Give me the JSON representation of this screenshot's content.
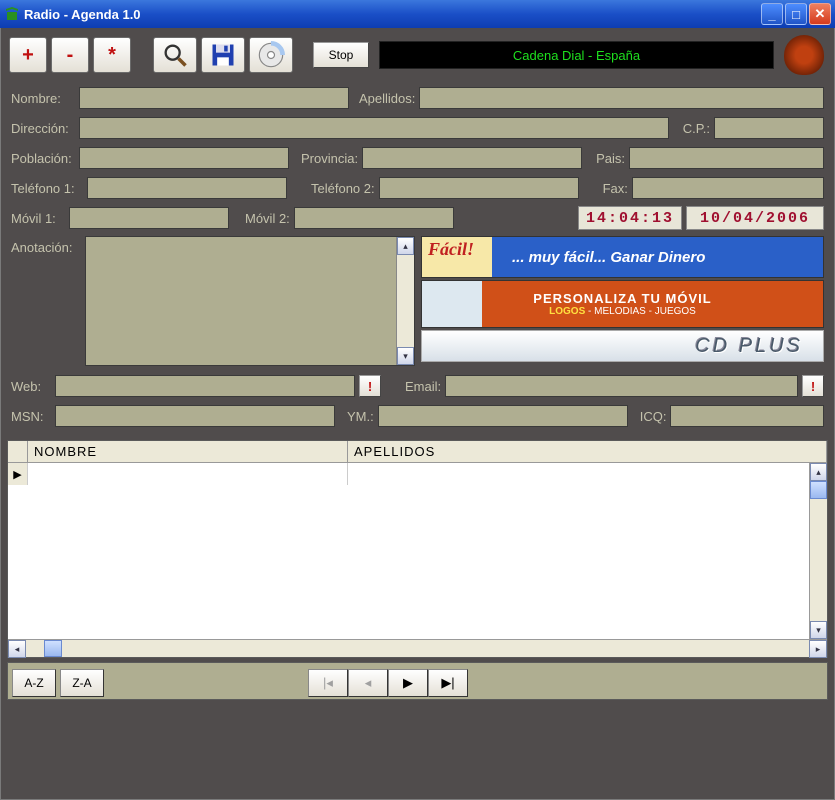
{
  "window": {
    "title": "Radio - Agenda 1.0"
  },
  "toolbar": {
    "add": "+",
    "remove": "-",
    "star": "*",
    "stop": "Stop",
    "radio_station": "Cadena Dial - España"
  },
  "form": {
    "nombre_lbl": "Nombre:",
    "apellidos_lbl": "Apellidos:",
    "direccion_lbl": "Dirección:",
    "cp_lbl": "C.P.:",
    "poblacion_lbl": "Población:",
    "provincia_lbl": "Provincia:",
    "pais_lbl": "Pais:",
    "tel1_lbl": "Teléfono 1:",
    "tel2_lbl": "Teléfono 2:",
    "fax_lbl": "Fax:",
    "movil1_lbl": "Móvil 1:",
    "movil2_lbl": "Móvil 2:",
    "anotacion_lbl": "Anotación:",
    "web_lbl": "Web:",
    "email_lbl": "Email:",
    "msn_lbl": "MSN:",
    "ym_lbl": "YM.:",
    "icq_lbl": "ICQ:"
  },
  "clock": {
    "time": "14:04:13",
    "date": "10/04/2006"
  },
  "ads": {
    "ad1_facil": "Fácil",
    "ad1_text": "... muy fácil... Ganar Dinero",
    "ad2_line1": "PERSONALIZA TU MÓVIL",
    "ad2_logos": "LOGOS",
    "ad2_melod": " - MELODIAS - JUEGOS",
    "ad3": "CD PLUS"
  },
  "grid": {
    "col1": "NOMBRE",
    "col2": "APELLIDOS"
  },
  "bottom": {
    "az": "A-Z",
    "za": "Z-A"
  },
  "bang": "!"
}
